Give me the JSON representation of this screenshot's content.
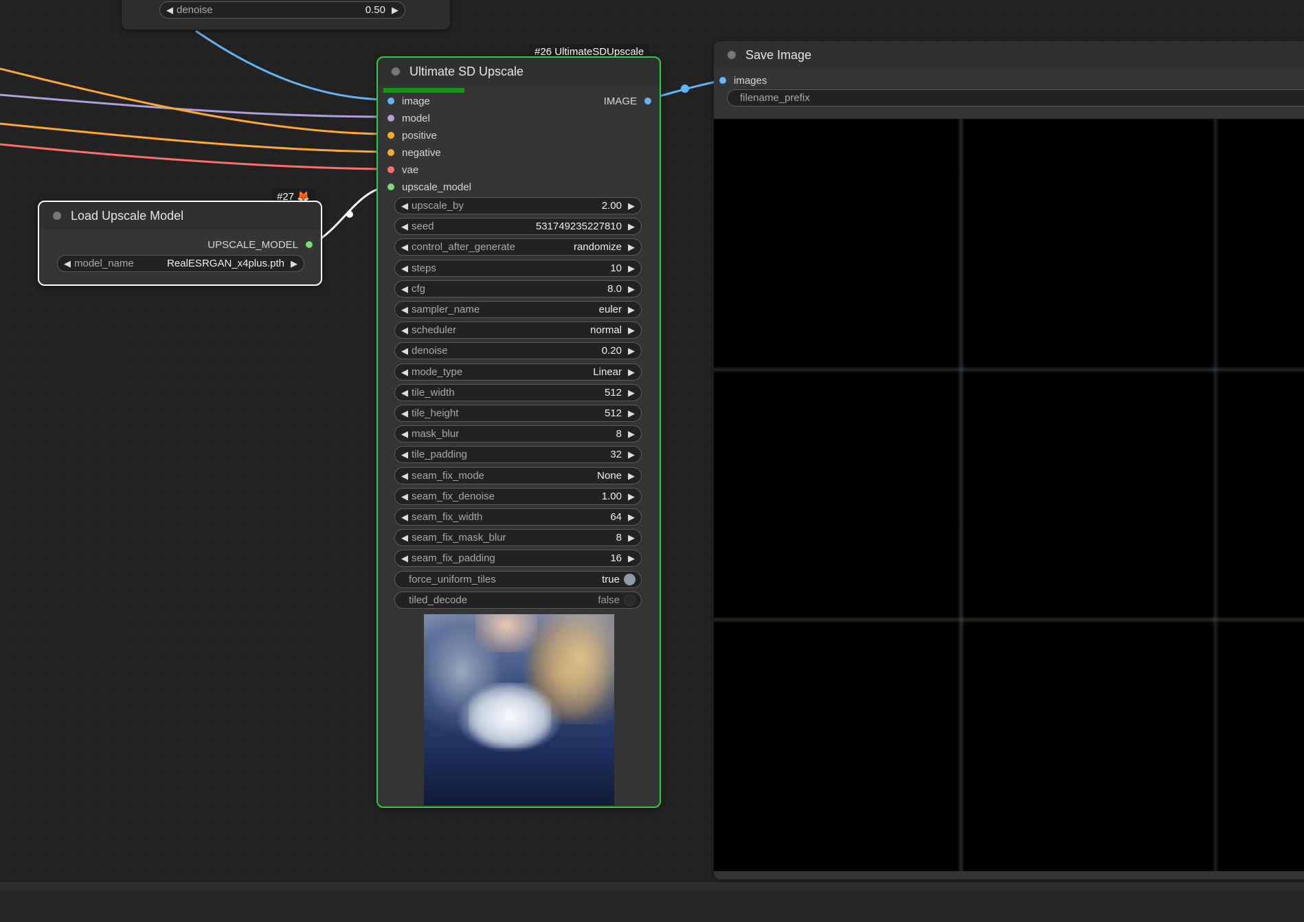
{
  "top_node": {
    "denoise_widget": {
      "label": "denoise",
      "value": "0.50"
    }
  },
  "load_upscale_model": {
    "badge": "#27 🦊",
    "title": "Load Upscale Model",
    "output_label": "UPSCALE_MODEL",
    "model_name_widget": {
      "label": "model_name",
      "value": "RealESRGAN_x4plus.pth"
    }
  },
  "ultimate_sd_upscale": {
    "badge": "#26 UltimateSDUpscale",
    "title": "Ultimate SD Upscale",
    "progress": 0.32,
    "inputs": [
      {
        "label": "image",
        "color": "#64b5f6"
      },
      {
        "label": "model",
        "color": "#b39ddb"
      },
      {
        "label": "positive",
        "color": "#ffa931"
      },
      {
        "label": "negative",
        "color": "#ffa931"
      },
      {
        "label": "vae",
        "color": "#ff6e6e"
      },
      {
        "label": "upscale_model",
        "color": "#7dd97d"
      }
    ],
    "output_label": "IMAGE",
    "widgets": [
      {
        "label": "upscale_by",
        "value": "2.00"
      },
      {
        "label": "seed",
        "value": "531749235227810"
      },
      {
        "label": "control_after_generate",
        "value": "randomize"
      },
      {
        "label": "steps",
        "value": "10"
      },
      {
        "label": "cfg",
        "value": "8.0"
      },
      {
        "label": "sampler_name",
        "value": "euler"
      },
      {
        "label": "scheduler",
        "value": "normal"
      },
      {
        "label": "denoise",
        "value": "0.20"
      },
      {
        "label": "mode_type",
        "value": "Linear"
      },
      {
        "label": "tile_width",
        "value": "512"
      },
      {
        "label": "tile_height",
        "value": "512"
      },
      {
        "label": "mask_blur",
        "value": "8"
      },
      {
        "label": "tile_padding",
        "value": "32"
      },
      {
        "label": "seam_fix_mode",
        "value": "None"
      },
      {
        "label": "seam_fix_denoise",
        "value": "1.00"
      },
      {
        "label": "seam_fix_width",
        "value": "64"
      },
      {
        "label": "seam_fix_mask_blur",
        "value": "8"
      },
      {
        "label": "seam_fix_padding",
        "value": "16"
      }
    ],
    "toggles": [
      {
        "label": "force_uniform_tiles",
        "value": "true",
        "on": true
      },
      {
        "label": "tiled_decode",
        "value": "false",
        "on": false
      }
    ]
  },
  "save_image": {
    "title": "Save Image",
    "input_label": "images",
    "filename_prefix_label": "filename_prefix"
  },
  "colors": {
    "image_link": "#64b5f6",
    "model_link": "#b39ddb",
    "conditioning_link": "#ffa931",
    "vae_link": "#ff6e6e",
    "upscale_model_link": "#ffffff",
    "selected_outline": "#2ecc40",
    "progress_bar": "#1a8f1a"
  },
  "icons": {
    "decrement": "◀",
    "increment": "▶",
    "title_dot": "status-dot-icon"
  }
}
